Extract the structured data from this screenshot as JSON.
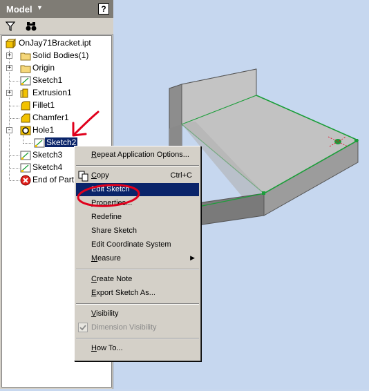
{
  "browser": {
    "title": "Model",
    "title_dropdown_icon": "triangle-down-icon",
    "help_label": "?",
    "toolbar": [
      {
        "name": "filter-icon"
      },
      {
        "name": "binoculars-icon"
      }
    ],
    "tree": [
      {
        "label": "OnJay71Bracket.ipt",
        "icon": "part-icon"
      },
      {
        "label": "Solid Bodies(1)",
        "icon": "folder-icon",
        "expander": "+"
      },
      {
        "label": "Origin",
        "icon": "folder-icon",
        "expander": "+"
      },
      {
        "label": "Sketch1",
        "icon": "sketch-icon"
      },
      {
        "label": "Extrusion1",
        "icon": "extrusion-icon",
        "expander": "+"
      },
      {
        "label": "Fillet1",
        "icon": "fillet-icon"
      },
      {
        "label": "Chamfer1",
        "icon": "chamfer-icon"
      },
      {
        "label": "Hole1",
        "icon": "hole-icon",
        "expander": "-"
      },
      {
        "label": "Sketch2",
        "icon": "sketch-icon",
        "selected": true
      },
      {
        "label": "Sketch3",
        "icon": "sketch-icon"
      },
      {
        "label": "Sketch4",
        "icon": "sketch-icon"
      },
      {
        "label": "End of Part",
        "icon": "end-of-part-icon"
      }
    ]
  },
  "context_menu": {
    "items": [
      {
        "label": "Repeat Application Options...",
        "underline": "R"
      },
      {
        "sep": true
      },
      {
        "label": "Copy",
        "shortcut": "Ctrl+C",
        "icon": "copy-icon",
        "underline": "C"
      },
      {
        "label": "Edit Sketch",
        "highlighted": true
      },
      {
        "label": "Properties...",
        "underline": "P"
      },
      {
        "label": "Redefine"
      },
      {
        "label": "Share Sketch"
      },
      {
        "label": "Edit Coordinate System"
      },
      {
        "label": "Measure",
        "submenu": true,
        "underline": "M"
      },
      {
        "sep": true
      },
      {
        "label": "Create Note",
        "underline": "C"
      },
      {
        "label": "Export Sketch As...",
        "underline": "E"
      },
      {
        "sep": true
      },
      {
        "label": "Visibility",
        "underline": "V"
      },
      {
        "label": "Dimension Visibility",
        "checked": true,
        "disabled": true
      },
      {
        "sep": true
      },
      {
        "label": "How To...",
        "underline": "H"
      }
    ]
  },
  "colors": {
    "viewport": "#c6d7ef",
    "selection": "#0a246a",
    "annotation": "#e0001c",
    "edge_green": "#1c9e3a"
  }
}
